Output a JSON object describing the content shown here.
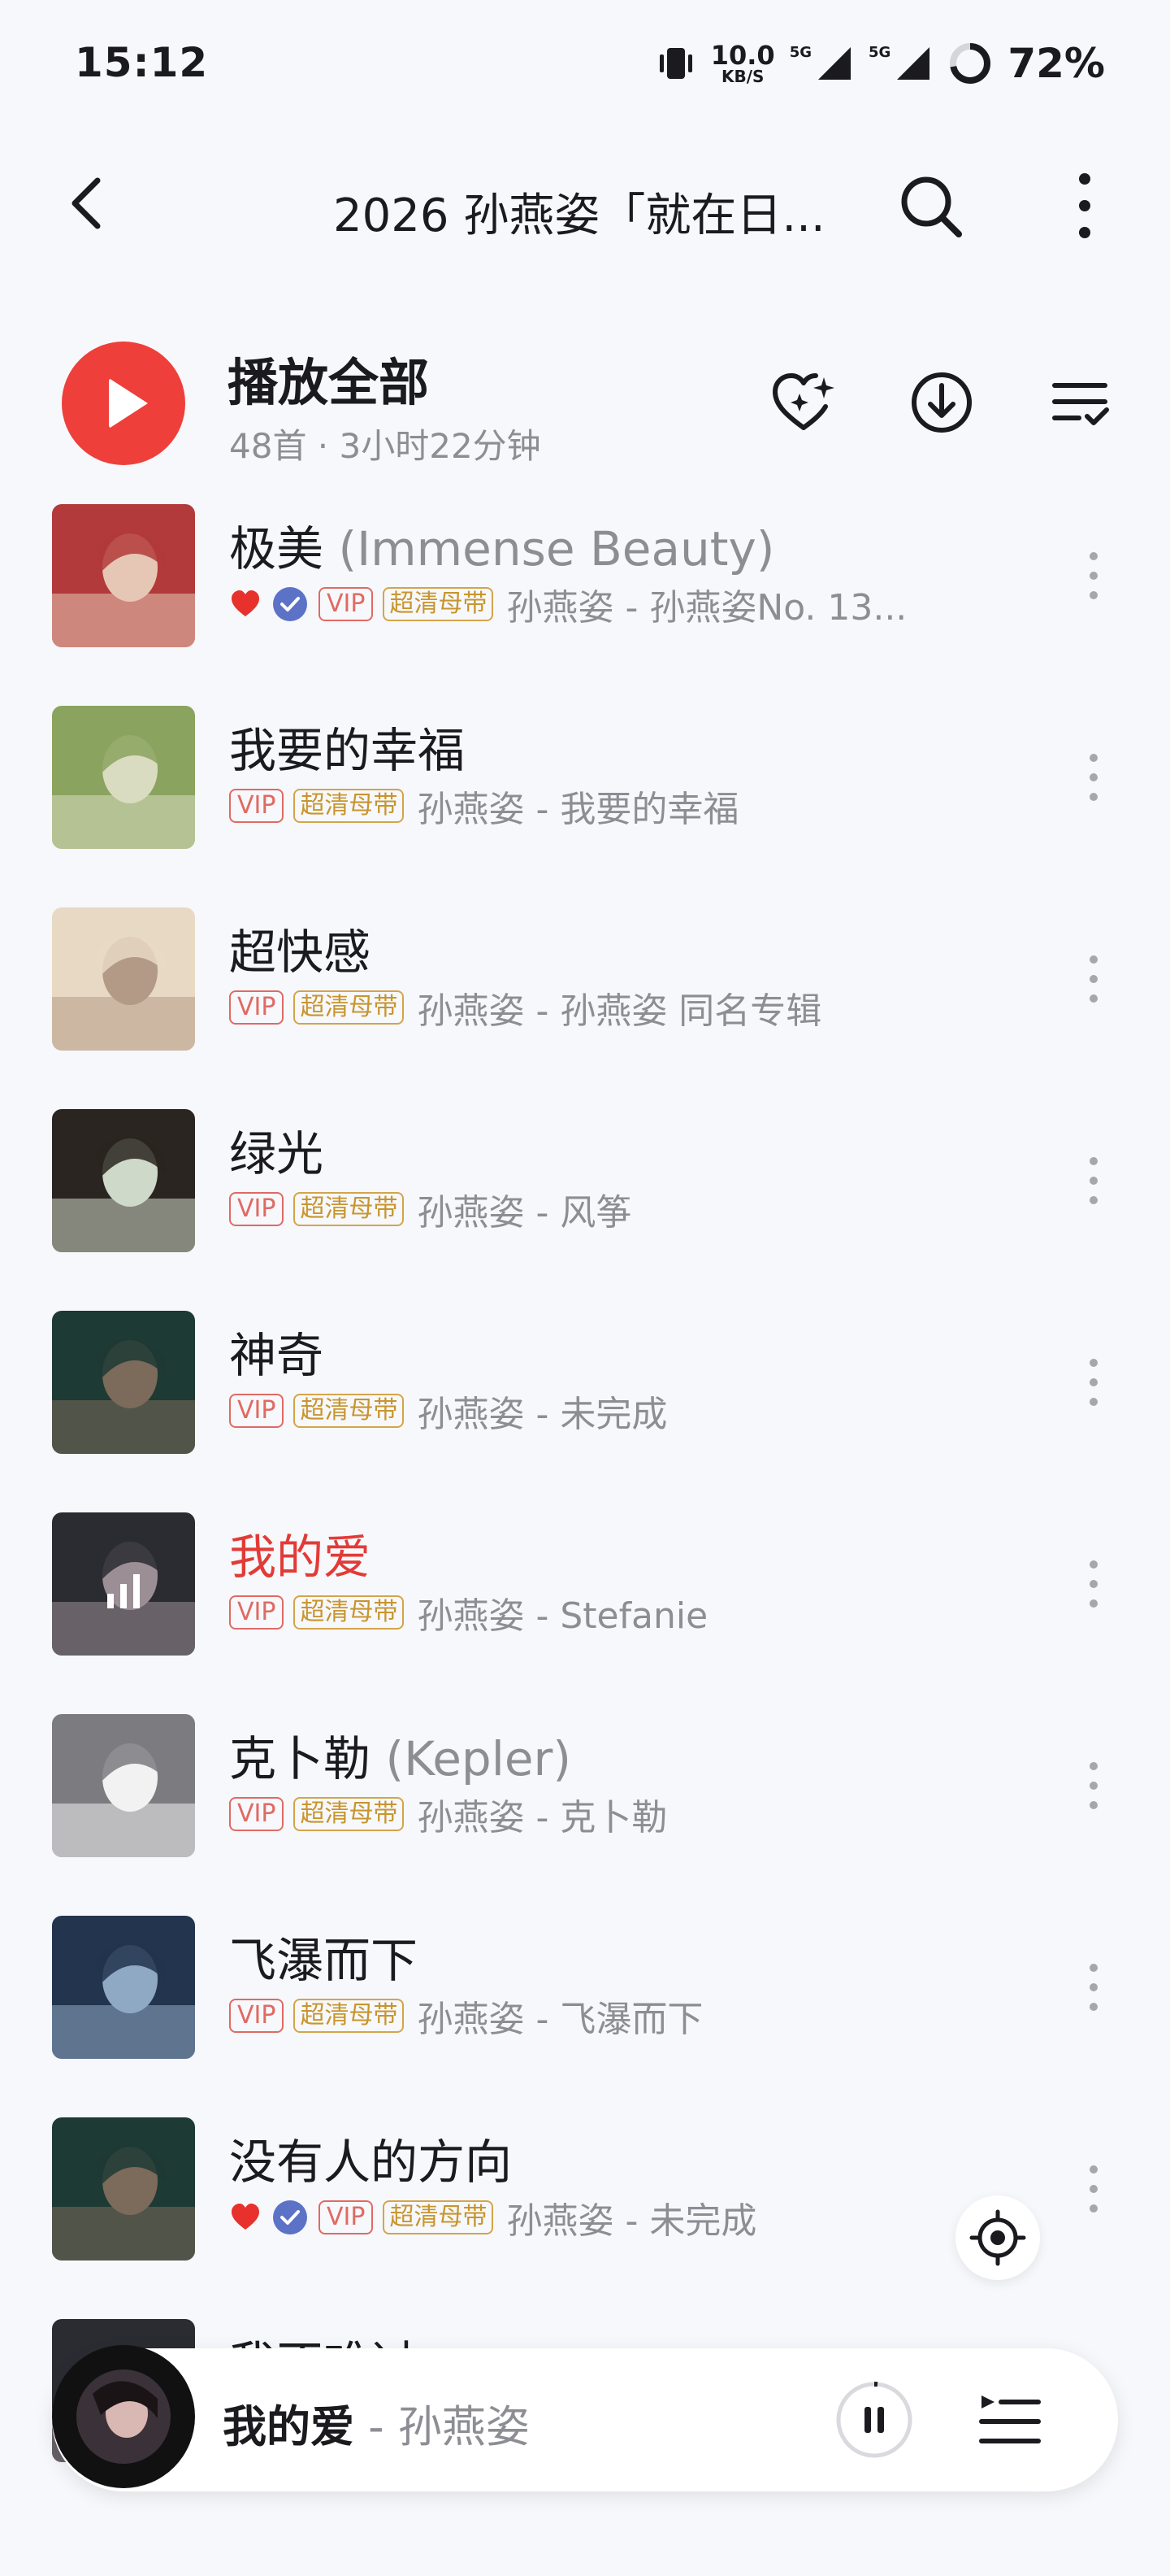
{
  "status_bar": {
    "time": "15:12",
    "net_speed_value": "10.0",
    "net_speed_unit": "KB/S",
    "net1": "5G",
    "net2": "5G",
    "battery": "72%"
  },
  "header": {
    "title": "2026 孙燕姿「就在日..."
  },
  "play_all": {
    "label": "播放全部",
    "meta": "48首 · 3小时22分钟"
  },
  "tags": {
    "vip": "VIP",
    "hq": "超清母带"
  },
  "songs": [
    {
      "title": "极美",
      "subtitle": " (Immense Beauty)",
      "meta": "孙燕姿 - 孙燕姿No. 13...",
      "liked": true,
      "cover": [
        "#b23a3a",
        "#e6c7b5"
      ]
    },
    {
      "title": "我要的幸福",
      "subtitle": "",
      "meta": "孙燕姿 - 我要的幸福",
      "liked": false,
      "cover": [
        "#8aa35e",
        "#d9dcc0"
      ]
    },
    {
      "title": "超快感",
      "subtitle": "",
      "meta": "孙燕姿 - 孙燕姿 同名专辑",
      "liked": false,
      "cover": [
        "#e8d9c4",
        "#b39a86"
      ]
    },
    {
      "title": "绿光",
      "subtitle": "",
      "meta": "孙燕姿 - 风筝",
      "liked": false,
      "cover": [
        "#2a2520",
        "#cfd9c9"
      ]
    },
    {
      "title": "神奇",
      "subtitle": "",
      "meta": "孙燕姿 - 未完成",
      "liked": false,
      "cover": [
        "#1e3a34",
        "#7c6a5a"
      ]
    },
    {
      "title": "我的爱",
      "subtitle": "",
      "meta": "孙燕姿 - Stefanie",
      "liked": false,
      "playing": true,
      "cover": [
        "#2b2b32",
        "#9b8f95"
      ]
    },
    {
      "title": "克卜勒",
      "subtitle": " (Kepler)",
      "meta": "孙燕姿 - 克卜勒",
      "liked": false,
      "cover": [
        "#7b7b80",
        "#f2f2f2"
      ]
    },
    {
      "title": "飞瀑而下",
      "subtitle": "",
      "meta": "孙燕姿 - 飞瀑而下",
      "liked": false,
      "cover": [
        "#22344e",
        "#8fa9c4"
      ]
    },
    {
      "title": "没有人的方向",
      "subtitle": "",
      "meta": "孙燕姿 - 未完成",
      "liked": true,
      "cover": [
        "#1e3a34",
        "#7c6a5a"
      ]
    },
    {
      "title": "我不难过",
      "subtitle": "",
      "meta": "",
      "liked": false,
      "cover": [
        "#2b2b32",
        "#9b8f95"
      ]
    }
  ],
  "mini_player": {
    "title": "我的爱",
    "artist": " - 孙燕姿"
  },
  "colors": {
    "accent": "#ee3f3a",
    "vip": "#e06a64",
    "hq": "#c8952f",
    "muted": "#8d8e94"
  },
  "icons": {
    "back": "chevron-left-icon",
    "search": "search-icon",
    "more": "more-vertical-icon",
    "fav": "heart-sparkle-icon",
    "download": "download-icon",
    "list": "list-check-icon",
    "locate": "locate-icon",
    "pause": "pause-icon",
    "queue": "queue-icon"
  }
}
